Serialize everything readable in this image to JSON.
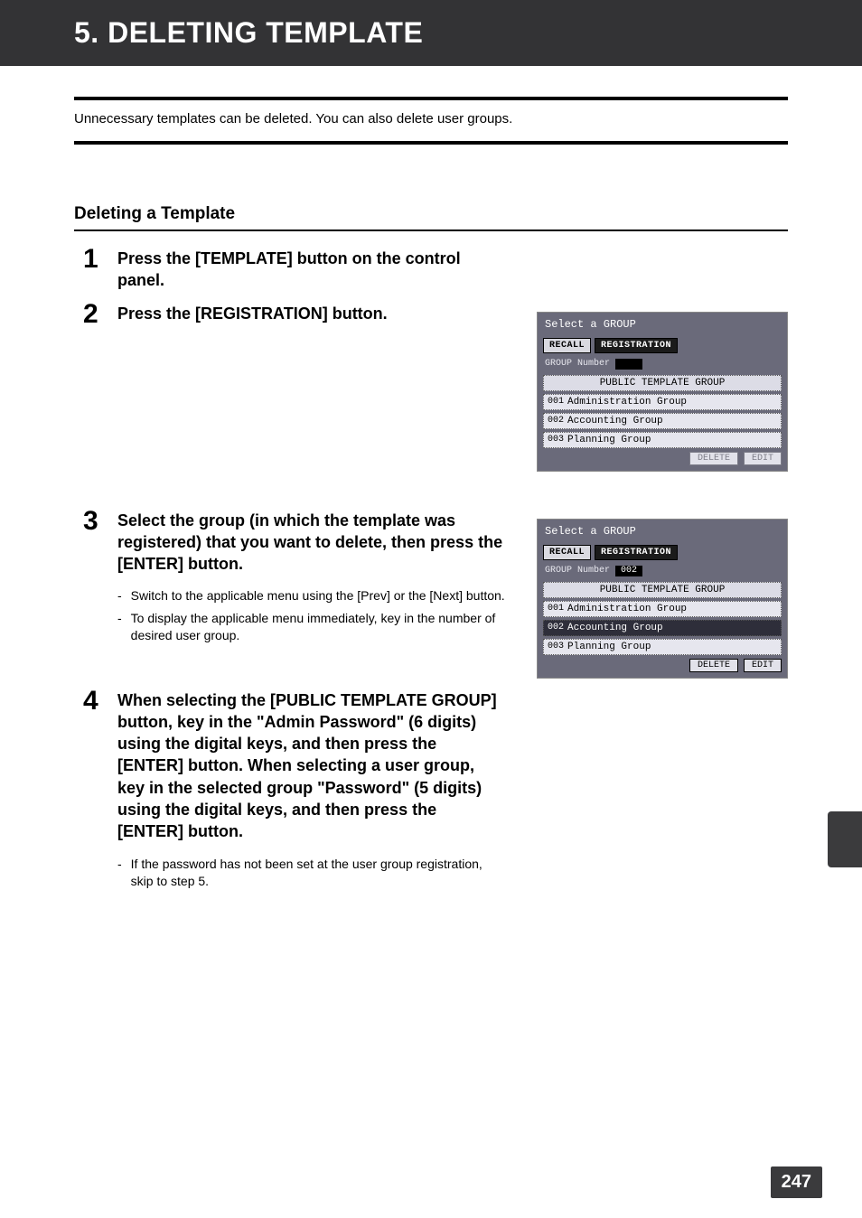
{
  "title": "5. DELETING TEMPLATE",
  "intro": "Unnecessary templates can be deleted. You can also delete user groups.",
  "subheading": "Deleting a Template",
  "steps": {
    "s1": {
      "num": "1",
      "title": "Press the [TEMPLATE] button on the control panel."
    },
    "s2": {
      "num": "2",
      "title": "Press the [REGISTRATION] button."
    },
    "s3": {
      "num": "3",
      "title": "Select the group (in which the template was registered) that you want to delete, then press the [ENTER] button.",
      "notes": [
        "Switch to the applicable menu using the [Prev] or the [Next] button.",
        "To display the applicable menu immediately, key in the number of desired user group."
      ]
    },
    "s4": {
      "num": "4",
      "title": "When selecting the [PUBLIC TEMPLATE GROUP] button, key in the \"Admin Password\" (6 digits) using the digital keys, and then press the [ENTER] button. When selecting a user group, key in the selected group \"Password\" (5 digits) using the digital keys, and then press the [ENTER] button.",
      "notes": [
        "If the password has not been set at the user group registration, skip to step 5."
      ]
    }
  },
  "lcd": {
    "header": "Select a GROUP",
    "tab_recall": "RECALL",
    "tab_registration": "REGISTRATION",
    "group_number_label": "GROUP Number",
    "group_number_value_sel": "002",
    "row_head": "PUBLIC TEMPLATE GROUP",
    "rows": [
      {
        "idx": "001",
        "label": "Administration Group"
      },
      {
        "idx": "002",
        "label": "Accounting Group"
      },
      {
        "idx": "003",
        "label": "Planning Group"
      }
    ],
    "btn_delete": "DELETE",
    "btn_edit": "EDIT"
  },
  "page_number": "247"
}
